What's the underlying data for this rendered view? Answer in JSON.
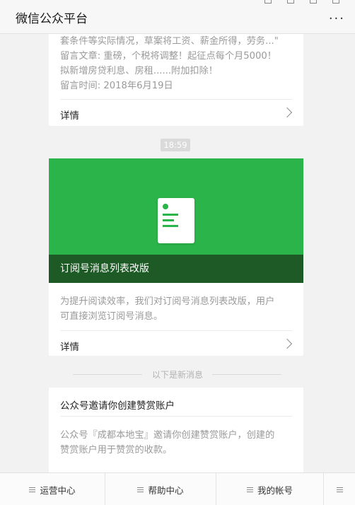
{
  "window": {
    "title": "微信公众平台",
    "more_label": "..."
  },
  "message1": {
    "text_line1": "套条件等实际情况，草案将工资、薪金所得，劳务...\"",
    "text_line2": "留言文章: 重磅，个税将调整！起征点每个月5000！",
    "text_line3": "拟新增房贷利息、房租......附加扣除！",
    "text_line4": "留言时间: 2018年6月19日",
    "details_label": "详情"
  },
  "timestamp": "18:59",
  "message2": {
    "banner_caption": "订阅号消息列表改版",
    "text_line1": "为提升阅读效率，我们对订阅号消息列表改版，用户",
    "text_line2": "可直接浏览订阅号消息。",
    "details_label": "详情"
  },
  "new_divider": "以下是新消息",
  "message3": {
    "title": "公众号邀请你创建赞赏账户",
    "text_line1": "公众号『成都本地宝』邀请你创建赞赏账户，创建的",
    "text_line2": "赞赏账户用于赞赏的收款。"
  },
  "bottom_nav": {
    "items": [
      {
        "label": "运营中心",
        "icon": "menu-icon"
      },
      {
        "label": "帮助中心",
        "icon": "menu-icon"
      },
      {
        "label": "我的帐号",
        "icon": "menu-icon"
      }
    ],
    "keyboard_toggle_icon": "keyboard-toggle-icon"
  },
  "colors": {
    "accent_green": "#2bb44a",
    "caption_dark_green": "#1e5a26"
  }
}
